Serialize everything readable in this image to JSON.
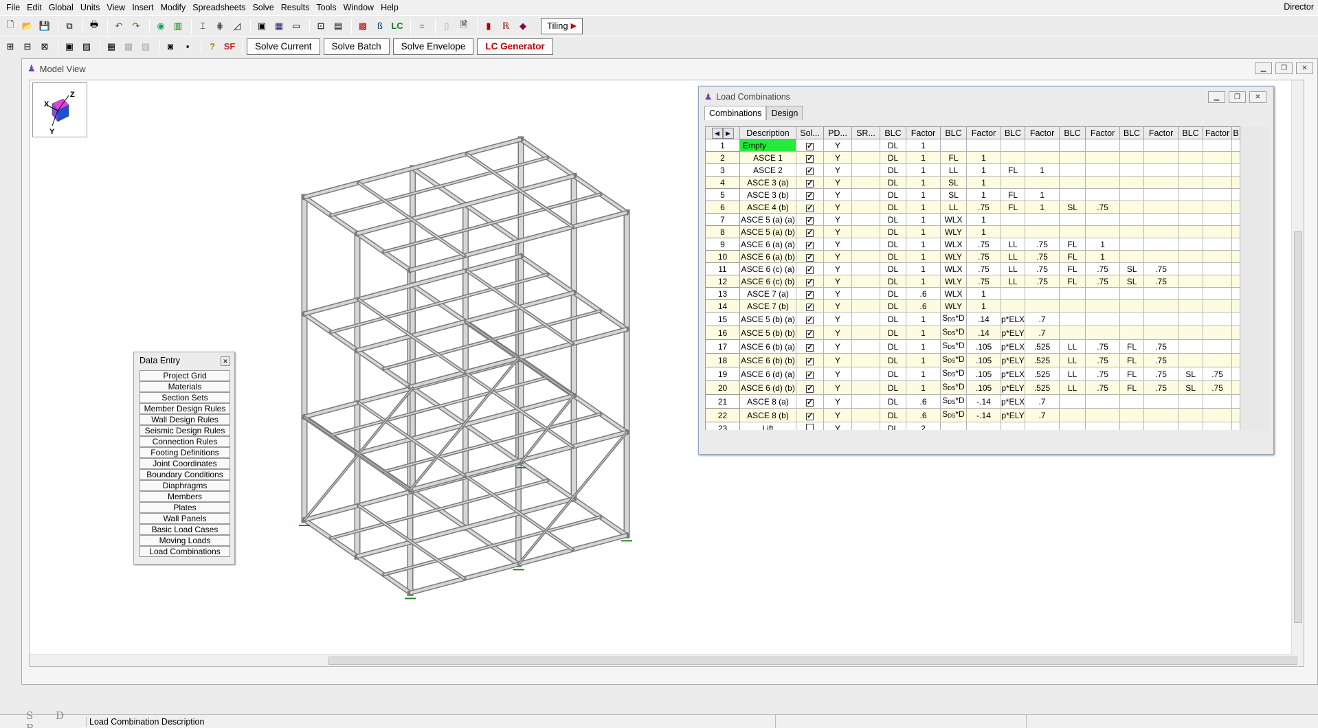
{
  "app": {
    "title": "Director"
  },
  "menu": [
    "File",
    "Edit",
    "Global",
    "Units",
    "View",
    "Insert",
    "Modify",
    "Spreadsheets",
    "Solve",
    "Results",
    "Tools",
    "Window",
    "Help"
  ],
  "toolbar": {
    "lc_label": "LC",
    "tiling": "Tiling",
    "sf_label": "SF",
    "solve_current": "Solve Current",
    "solve_batch": "Solve Batch",
    "solve_envelope": "Solve Envelope",
    "lc_generator": "LC Generator"
  },
  "model_view": {
    "title": "Model View",
    "axes": {
      "z": "Z",
      "x": "X",
      "y": "Y"
    }
  },
  "data_entry": {
    "title": "Data Entry",
    "items": [
      "Project Grid",
      "Materials",
      "Section Sets",
      "Member Design Rules",
      "Wall Design Rules",
      "Seismic Design Rules",
      "Connection Rules",
      "Footing Definitions",
      "Joint Coordinates",
      "Boundary Conditions",
      "Diaphragms",
      "Members",
      "Plates",
      "Wall Panels",
      "Basic Load Cases",
      "Moving Loads",
      "Load Combinations"
    ]
  },
  "load_combinations": {
    "title": "Load Combinations",
    "tabs": [
      "Combinations",
      "Design"
    ],
    "columns": [
      "Description",
      "Sol...",
      "PD...",
      "SR...",
      "BLC",
      "Factor",
      "BLC",
      "Factor",
      "BLC",
      "Factor",
      "BLC",
      "Factor",
      "BLC",
      "Factor",
      "BLC",
      "Factor",
      "B"
    ],
    "rows": [
      {
        "n": "1",
        "desc": "Empty",
        "sol": true,
        "pd": "Y",
        "sr": "",
        "cells": [
          "DL",
          "1",
          "",
          "",
          "",
          "",
          "",
          "",
          "",
          "",
          "",
          ""
        ]
      },
      {
        "n": "2",
        "desc": "ASCE 1",
        "sol": true,
        "pd": "Y",
        "sr": "",
        "cells": [
          "DL",
          "1",
          "FL",
          "1",
          "",
          "",
          "",
          "",
          "",
          "",
          "",
          ""
        ]
      },
      {
        "n": "3",
        "desc": "ASCE 2",
        "sol": true,
        "pd": "Y",
        "sr": "",
        "cells": [
          "DL",
          "1",
          "LL",
          "1",
          "FL",
          "1",
          "",
          "",
          "",
          "",
          "",
          ""
        ]
      },
      {
        "n": "4",
        "desc": "ASCE 3 (a)",
        "sol": true,
        "pd": "Y",
        "sr": "",
        "cells": [
          "DL",
          "1",
          "SL",
          "1",
          "",
          "",
          "",
          "",
          "",
          "",
          "",
          ""
        ]
      },
      {
        "n": "5",
        "desc": "ASCE 3 (b)",
        "sol": true,
        "pd": "Y",
        "sr": "",
        "cells": [
          "DL",
          "1",
          "SL",
          "1",
          "FL",
          "1",
          "",
          "",
          "",
          "",
          "",
          ""
        ]
      },
      {
        "n": "6",
        "desc": "ASCE 4 (b)",
        "sol": true,
        "pd": "Y",
        "sr": "",
        "cells": [
          "DL",
          "1",
          "LL",
          ".75",
          "FL",
          "1",
          "SL",
          ".75",
          "",
          "",
          "",
          ""
        ]
      },
      {
        "n": "7",
        "desc": "ASCE 5 (a) (a)",
        "sol": true,
        "pd": "Y",
        "sr": "",
        "cells": [
          "DL",
          "1",
          "WLX",
          "1",
          "",
          "",
          "",
          "",
          "",
          "",
          "",
          ""
        ]
      },
      {
        "n": "8",
        "desc": "ASCE 5 (a) (b)",
        "sol": true,
        "pd": "Y",
        "sr": "",
        "cells": [
          "DL",
          "1",
          "WLY",
          "1",
          "",
          "",
          "",
          "",
          "",
          "",
          "",
          ""
        ]
      },
      {
        "n": "9",
        "desc": "ASCE 6 (a) (a)",
        "sol": true,
        "pd": "Y",
        "sr": "",
        "cells": [
          "DL",
          "1",
          "WLX",
          ".75",
          "LL",
          ".75",
          "FL",
          "1",
          "",
          "",
          "",
          ""
        ]
      },
      {
        "n": "10",
        "desc": "ASCE 6 (a) (b)",
        "sol": true,
        "pd": "Y",
        "sr": "",
        "cells": [
          "DL",
          "1",
          "WLY",
          ".75",
          "LL",
          ".75",
          "FL",
          "1",
          "",
          "",
          "",
          ""
        ]
      },
      {
        "n": "11",
        "desc": "ASCE 6 (c) (a)",
        "sol": true,
        "pd": "Y",
        "sr": "",
        "cells": [
          "DL",
          "1",
          "WLX",
          ".75",
          "LL",
          ".75",
          "FL",
          ".75",
          "SL",
          ".75",
          "",
          ""
        ]
      },
      {
        "n": "12",
        "desc": "ASCE 6 (c) (b)",
        "sol": true,
        "pd": "Y",
        "sr": "",
        "cells": [
          "DL",
          "1",
          "WLY",
          ".75",
          "LL",
          ".75",
          "FL",
          ".75",
          "SL",
          ".75",
          "",
          ""
        ]
      },
      {
        "n": "13",
        "desc": "ASCE 7 (a)",
        "sol": true,
        "pd": "Y",
        "sr": "",
        "cells": [
          "DL",
          ".6",
          "WLX",
          "1",
          "",
          "",
          "",
          "",
          "",
          "",
          "",
          ""
        ]
      },
      {
        "n": "14",
        "desc": "ASCE 7 (b)",
        "sol": true,
        "pd": "Y",
        "sr": "",
        "cells": [
          "DL",
          ".6",
          "WLY",
          "1",
          "",
          "",
          "",
          "",
          "",
          "",
          "",
          ""
        ]
      },
      {
        "n": "15",
        "desc": "ASCE 5 (b) (a)",
        "sol": true,
        "pd": "Y",
        "sr": "",
        "cells": [
          "DL",
          "1",
          "SDS*D",
          ".14",
          "p*ELX",
          ".7",
          "",
          "",
          "",
          "",
          "",
          ""
        ]
      },
      {
        "n": "16",
        "desc": "ASCE 5 (b) (b)",
        "sol": true,
        "pd": "Y",
        "sr": "",
        "cells": [
          "DL",
          "1",
          "SDS*D",
          ".14",
          "p*ELY",
          ".7",
          "",
          "",
          "",
          "",
          "",
          ""
        ]
      },
      {
        "n": "17",
        "desc": "ASCE 6 (b) (a)",
        "sol": true,
        "pd": "Y",
        "sr": "",
        "cells": [
          "DL",
          "1",
          "SDS*D",
          ".105",
          "p*ELX",
          ".525",
          "LL",
          ".75",
          "FL",
          ".75",
          "",
          ""
        ]
      },
      {
        "n": "18",
        "desc": "ASCE 6 (b) (b)",
        "sol": true,
        "pd": "Y",
        "sr": "",
        "cells": [
          "DL",
          "1",
          "SDS*D",
          ".105",
          "p*ELY",
          ".525",
          "LL",
          ".75",
          "FL",
          ".75",
          "",
          ""
        ]
      },
      {
        "n": "19",
        "desc": "ASCE 6 (d) (a)",
        "sol": true,
        "pd": "Y",
        "sr": "",
        "cells": [
          "DL",
          "1",
          "SDS*D",
          ".105",
          "p*ELX",
          ".525",
          "LL",
          ".75",
          "FL",
          ".75",
          "SL",
          ".75"
        ]
      },
      {
        "n": "20",
        "desc": "ASCE 6 (d) (b)",
        "sol": true,
        "pd": "Y",
        "sr": "",
        "cells": [
          "DL",
          "1",
          "SDS*D",
          ".105",
          "p*ELY",
          ".525",
          "LL",
          ".75",
          "FL",
          ".75",
          "SL",
          ".75"
        ]
      },
      {
        "n": "21",
        "desc": "ASCE 8 (a)",
        "sol": true,
        "pd": "Y",
        "sr": "",
        "cells": [
          "DL",
          ".6",
          "SDS*D",
          "-.14",
          "p*ELX",
          ".7",
          "",
          "",
          "",
          "",
          "",
          ""
        ]
      },
      {
        "n": "22",
        "desc": "ASCE 8 (b)",
        "sol": true,
        "pd": "Y",
        "sr": "",
        "cells": [
          "DL",
          ".6",
          "SDS*D",
          "-.14",
          "p*ELY",
          ".7",
          "",
          "",
          "",
          "",
          "",
          ""
        ]
      },
      {
        "n": "23",
        "desc": "Lift",
        "sol": false,
        "pd": "Y",
        "sr": "",
        "cells": [
          "DL",
          "2",
          "",
          "",
          "",
          "",
          "",
          "",
          "",
          "",
          "",
          ""
        ]
      }
    ]
  },
  "status": {
    "sdr": "S D R",
    "text": "Load Combination Description"
  },
  "colors": {
    "selected_cell": "#28ea3c",
    "odd_row": "#ffffff",
    "even_row": "#fdfbe0",
    "accent_red": "#c00000"
  }
}
